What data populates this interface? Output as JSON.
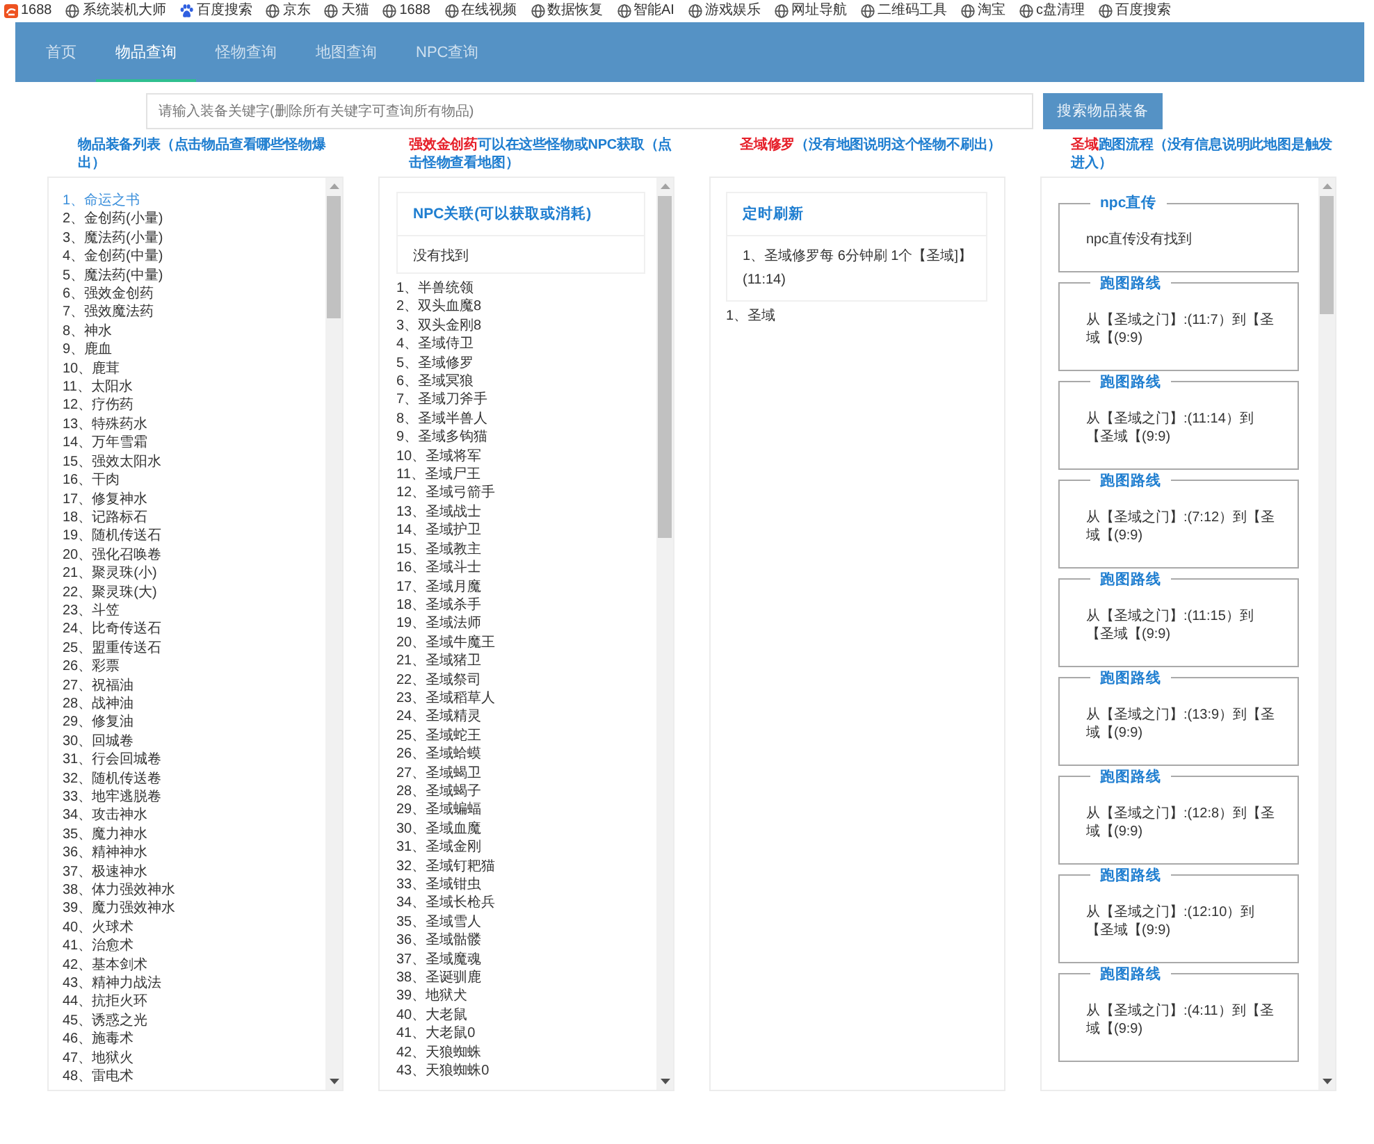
{
  "bookmarks": [
    {
      "kind": "logo",
      "label": "1688"
    },
    {
      "kind": "globe",
      "label": "系统装机大师"
    },
    {
      "kind": "paw",
      "label": "百度搜索"
    },
    {
      "kind": "globe",
      "label": "京东"
    },
    {
      "kind": "globe",
      "label": "天猫"
    },
    {
      "kind": "globe",
      "label": "1688"
    },
    {
      "kind": "globe",
      "label": "在线视频"
    },
    {
      "kind": "globe",
      "label": "数据恢复"
    },
    {
      "kind": "globe",
      "label": "智能AI"
    },
    {
      "kind": "globe",
      "label": "游戏娱乐"
    },
    {
      "kind": "globe",
      "label": "网址导航"
    },
    {
      "kind": "globe",
      "label": "二维码工具"
    },
    {
      "kind": "globe",
      "label": "淘宝"
    },
    {
      "kind": "globe",
      "label": "c盘清理"
    },
    {
      "kind": "globe",
      "label": "百度搜索"
    }
  ],
  "nav": {
    "tabs": [
      {
        "label": "首页",
        "selected": false
      },
      {
        "label": "物品查询",
        "selected": true
      },
      {
        "label": "怪物查询",
        "selected": false
      },
      {
        "label": "地图查询",
        "selected": false
      },
      {
        "label": "NPC查询",
        "selected": false
      }
    ]
  },
  "search": {
    "placeholder": "请输入装备关键字(删除所有关键字可查询所有物品)",
    "button": "搜索物品装备"
  },
  "item_list": {
    "title": "物品装备列表（点击物品查看哪些怪物爆出）",
    "items": [
      {
        "label": "1、命运之书",
        "selected": true
      },
      {
        "label": "2、金创药(小量)",
        "selected": false
      },
      {
        "label": "3、魔法药(小量)",
        "selected": false
      },
      {
        "label": "4、金创药(中量)",
        "selected": false
      },
      {
        "label": "5、魔法药(中量)",
        "selected": false
      },
      {
        "label": "6、强效金创药",
        "selected": false
      },
      {
        "label": "7、强效魔法药",
        "selected": false
      },
      {
        "label": "8、神水",
        "selected": false
      },
      {
        "label": "9、鹿血",
        "selected": false
      },
      {
        "label": "10、鹿茸",
        "selected": false
      },
      {
        "label": "11、太阳水",
        "selected": false
      },
      {
        "label": "12、疗伤药",
        "selected": false
      },
      {
        "label": "13、特殊药水",
        "selected": false
      },
      {
        "label": "14、万年雪霜",
        "selected": false
      },
      {
        "label": "15、强效太阳水",
        "selected": false
      },
      {
        "label": "16、干肉",
        "selected": false
      },
      {
        "label": "17、修复神水",
        "selected": false
      },
      {
        "label": "18、记路标石",
        "selected": false
      },
      {
        "label": "19、随机传送石",
        "selected": false
      },
      {
        "label": "20、强化召唤卷",
        "selected": false
      },
      {
        "label": "21、聚灵珠(小)",
        "selected": false
      },
      {
        "label": "22、聚灵珠(大)",
        "selected": false
      },
      {
        "label": "23、斗笠",
        "selected": false
      },
      {
        "label": "24、比奇传送石",
        "selected": false
      },
      {
        "label": "25、盟重传送石",
        "selected": false
      },
      {
        "label": "26、彩票",
        "selected": false
      },
      {
        "label": "27、祝福油",
        "selected": false
      },
      {
        "label": "28、战神油",
        "selected": false
      },
      {
        "label": "29、修复油",
        "selected": false
      },
      {
        "label": "30、回城卷",
        "selected": false
      },
      {
        "label": "31、行会回城卷",
        "selected": false
      },
      {
        "label": "32、随机传送卷",
        "selected": false
      },
      {
        "label": "33、地牢逃脱卷",
        "selected": false
      },
      {
        "label": "34、攻击神水",
        "selected": false
      },
      {
        "label": "35、魔力神水",
        "selected": false
      },
      {
        "label": "36、精神神水",
        "selected": false
      },
      {
        "label": "37、极速神水",
        "selected": false
      },
      {
        "label": "38、体力强效神水",
        "selected": false
      },
      {
        "label": "39、魔力强效神水",
        "selected": false
      },
      {
        "label": "40、火球术",
        "selected": false
      },
      {
        "label": "41、治愈术",
        "selected": false
      },
      {
        "label": "42、基本剑术",
        "selected": false
      },
      {
        "label": "43、精神力战法",
        "selected": false
      },
      {
        "label": "44、抗拒火环",
        "selected": false
      },
      {
        "label": "45、诱惑之光",
        "selected": false
      },
      {
        "label": "46、施毒术",
        "selected": false
      },
      {
        "label": "47、地狱火",
        "selected": false
      },
      {
        "label": "48、雷电术",
        "selected": false
      }
    ]
  },
  "source_panel": {
    "title_highlight": "强效金创药",
    "title": "可以在这些怪物或NPC获取（点击怪物查看地图）",
    "npc_card": {
      "heading": "NPC关联(可以获取或消耗)",
      "text": "没有找到"
    },
    "monsters": [
      "1、半兽统领",
      "2、双头血魔8",
      "3、双头金刚8",
      "4、圣域侍卫",
      "5、圣域修罗",
      "6、圣域冥狼",
      "7、圣域刀斧手",
      "8、圣域半兽人",
      "9、圣域多钩猫",
      "10、圣域将军",
      "11、圣域尸王",
      "12、圣域弓箭手",
      "13、圣域战士",
      "14、圣域护卫",
      "15、圣域教主",
      "16、圣域斗士",
      "17、圣域月魔",
      "18、圣域杀手",
      "19、圣域法师",
      "20、圣域牛魔王",
      "21、圣域猪卫",
      "22、圣域祭司",
      "23、圣域稻草人",
      "24、圣域精灵",
      "25、圣域蛇王",
      "26、圣域蛤蟆",
      "27、圣域蝎卫",
      "28、圣域蝎子",
      "29、圣域蝙蝠",
      "30、圣域血魔",
      "31、圣域金刚",
      "32、圣域钉耙猫",
      "33、圣域钳虫",
      "34、圣域长枪兵",
      "35、圣域雪人",
      "36、圣域骷髅",
      "37、圣域魔魂",
      "38、圣诞驯鹿",
      "39、地狱犬",
      "40、大老鼠",
      "41、大老鼠0",
      "42、天狼蜘蛛",
      "43、天狼蜘蛛0"
    ]
  },
  "monster_panel": {
    "title_highlight": "圣域修罗",
    "title": "（没有地图说明这个怪物不刷出）",
    "refresh_card": {
      "heading": "定时刷新",
      "text": "1、圣域修罗每 6分钟刷 1个【圣域]】(11:14)"
    },
    "maps": [
      "1、圣域"
    ]
  },
  "route_panel": {
    "title_highlight": "圣域",
    "title": "跑图流程（没有信息说明此地图是触发进入）",
    "groups": [
      {
        "legend": "npc直传",
        "text": "npc直传没有找到"
      },
      {
        "legend": "跑图路线",
        "text": "从【圣域之门】:(11:7）到【圣域【(9:9)"
      },
      {
        "legend": "跑图路线",
        "text": "从【圣域之门】:(11:14）到【圣域【(9:9)"
      },
      {
        "legend": "跑图路线",
        "text": "从【圣域之门】:(7:12）到【圣域【(9:9)"
      },
      {
        "legend": "跑图路线",
        "text": "从【圣域之门】:(11:15）到【圣域【(9:9)"
      },
      {
        "legend": "跑图路线",
        "text": "从【圣域之门】:(13:9）到【圣域【(9:9)"
      },
      {
        "legend": "跑图路线",
        "text": "从【圣域之门】:(12:8）到【圣域【(9:9)"
      },
      {
        "legend": "跑图路线",
        "text": "从【圣域之门】:(12:10）到【圣域【(9:9)"
      },
      {
        "legend": "跑图路线",
        "text": "从【圣域之门】:(4:11）到【圣域【(9:9)"
      }
    ]
  }
}
